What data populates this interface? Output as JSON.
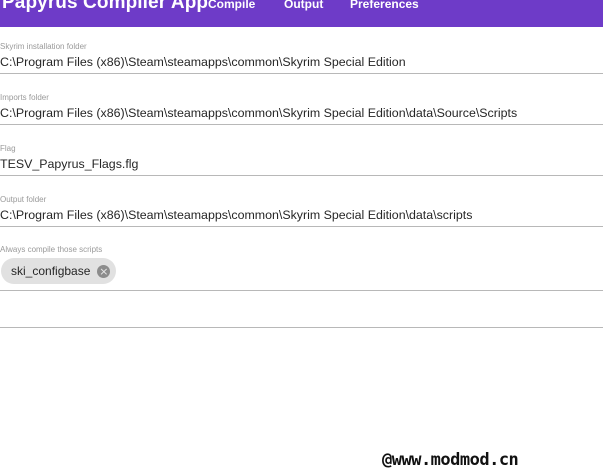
{
  "app": {
    "title": "Papyrus Compiler App",
    "accent_color": "#6e3bc8"
  },
  "nav": {
    "compile": "Compile",
    "output": "Output",
    "preferences": "Preferences"
  },
  "fields": {
    "skyrim_folder": {
      "label": "Skyrim installation folder",
      "value": "C:\\Program Files (x86)\\Steam\\steamapps\\common\\Skyrim Special Edition"
    },
    "imports_folder": {
      "label": "Imports folder",
      "value": "C:\\Program Files (x86)\\Steam\\steamapps\\common\\Skyrim Special Edition\\data\\Source\\Scripts"
    },
    "flag": {
      "label": "Flag",
      "value": "TESV_Papyrus_Flags.flg"
    },
    "output_folder": {
      "label": "Output folder",
      "value": "C:\\Program Files (x86)\\Steam\\steamapps\\common\\Skyrim Special Edition\\data\\scripts"
    },
    "always_compile": {
      "label": "Always compile those scripts",
      "chips": [
        "ski_configbase"
      ],
      "remove_icon": "close-circle-icon"
    }
  },
  "watermark": "@www.modmod.cn"
}
